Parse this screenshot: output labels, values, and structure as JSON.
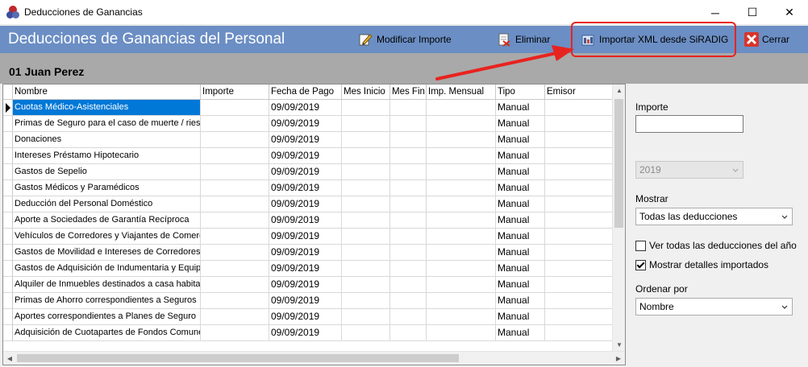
{
  "window": {
    "title": "Deducciones de Ganancias",
    "minimize_glyph": "─",
    "maximize_glyph": "☐",
    "close_glyph": "✕"
  },
  "header": {
    "title": "Deducciones de Ganancias del Personal",
    "buttons": [
      {
        "label": "Modificar Importe",
        "icon": "edit-icon"
      },
      {
        "label": "Eliminar",
        "icon": "delete-icon"
      },
      {
        "label": "Importar XML desde SiRADIG",
        "icon": "import-icon"
      },
      {
        "label": "Cerrar",
        "icon": "close-icon"
      }
    ]
  },
  "employee": {
    "name": "01 Juan Perez"
  },
  "grid": {
    "columns": [
      "Nombre",
      "Importe",
      "Fecha de Pago",
      "Mes Inicio",
      "Mes Fin",
      "Imp. Mensual",
      "Tipo",
      "Emisor"
    ],
    "rows": [
      {
        "nombre": "Cuotas Médico-Asistenciales",
        "importe": "",
        "fecha": "09/09/2019",
        "mes_inicio": "",
        "mes_fin": "",
        "imp_mensual": "",
        "tipo": "Manual",
        "emisor": ""
      },
      {
        "nombre": "Primas de Seguro para el caso de muerte / riesg",
        "importe": "",
        "fecha": "09/09/2019",
        "mes_inicio": "",
        "mes_fin": "",
        "imp_mensual": "",
        "tipo": "Manual",
        "emisor": ""
      },
      {
        "nombre": "Donaciones",
        "importe": "",
        "fecha": "09/09/2019",
        "mes_inicio": "",
        "mes_fin": "",
        "imp_mensual": "",
        "tipo": "Manual",
        "emisor": ""
      },
      {
        "nombre": "Intereses Préstamo Hipotecario",
        "importe": "",
        "fecha": "09/09/2019",
        "mes_inicio": "",
        "mes_fin": "",
        "imp_mensual": "",
        "tipo": "Manual",
        "emisor": ""
      },
      {
        "nombre": "Gastos de Sepelio",
        "importe": "",
        "fecha": "09/09/2019",
        "mes_inicio": "",
        "mes_fin": "",
        "imp_mensual": "",
        "tipo": "Manual",
        "emisor": ""
      },
      {
        "nombre": "Gastos Médicos y Paramédicos",
        "importe": "",
        "fecha": "09/09/2019",
        "mes_inicio": "",
        "mes_fin": "",
        "imp_mensual": "",
        "tipo": "Manual",
        "emisor": ""
      },
      {
        "nombre": "Deducción del Personal Doméstico",
        "importe": "",
        "fecha": "09/09/2019",
        "mes_inicio": "",
        "mes_fin": "",
        "imp_mensual": "",
        "tipo": "Manual",
        "emisor": ""
      },
      {
        "nombre": "Aporte a Sociedades de Garantía Recíproca",
        "importe": "",
        "fecha": "09/09/2019",
        "mes_inicio": "",
        "mes_fin": "",
        "imp_mensual": "",
        "tipo": "Manual",
        "emisor": ""
      },
      {
        "nombre": "Vehículos de Corredores y Viajantes de Comerc",
        "importe": "",
        "fecha": "09/09/2019",
        "mes_inicio": "",
        "mes_fin": "",
        "imp_mensual": "",
        "tipo": "Manual",
        "emisor": ""
      },
      {
        "nombre": "Gastos de Movilidad e Intereses de Corredores",
        "importe": "",
        "fecha": "09/09/2019",
        "mes_inicio": "",
        "mes_fin": "",
        "imp_mensual": "",
        "tipo": "Manual",
        "emisor": ""
      },
      {
        "nombre": "Gastos de Adquisición de Indumentaria y Equipa",
        "importe": "",
        "fecha": "09/09/2019",
        "mes_inicio": "",
        "mes_fin": "",
        "imp_mensual": "",
        "tipo": "Manual",
        "emisor": ""
      },
      {
        "nombre": "Alquiler de Inmuebles destinados a casa habitac",
        "importe": "",
        "fecha": "09/09/2019",
        "mes_inicio": "",
        "mes_fin": "",
        "imp_mensual": "",
        "tipo": "Manual",
        "emisor": ""
      },
      {
        "nombre": "Primas de Ahorro correspondientes a Seguros",
        "importe": "",
        "fecha": "09/09/2019",
        "mes_inicio": "",
        "mes_fin": "",
        "imp_mensual": "",
        "tipo": "Manual",
        "emisor": ""
      },
      {
        "nombre": "Aportes correspondientes a Planes de Seguro",
        "importe": "",
        "fecha": "09/09/2019",
        "mes_inicio": "",
        "mes_fin": "",
        "imp_mensual": "",
        "tipo": "Manual",
        "emisor": ""
      },
      {
        "nombre": "Adquisición de Cuotapartes de Fondos Comune",
        "importe": "",
        "fecha": "09/09/2019",
        "mes_inicio": "",
        "mes_fin": "",
        "imp_mensual": "",
        "tipo": "Manual",
        "emisor": ""
      }
    ]
  },
  "panel": {
    "importe_label": "Importe",
    "importe_value": "",
    "year_value": "2019",
    "mostrar_label": "Mostrar",
    "mostrar_value": "Todas las deducciones",
    "ver_todas_label": "Ver todas las deducciones del año",
    "ver_todas_checked": false,
    "mostrar_detalles_label": "Mostrar detalles importados",
    "mostrar_detalles_checked": true,
    "ordenar_label": "Ordenar por",
    "ordenar_value": "Nombre"
  },
  "colors": {
    "header_bg": "#6b8ec4",
    "employee_bar_bg": "#a9a9a9",
    "selection": "#0078d7",
    "annotation": "#e8231f"
  }
}
